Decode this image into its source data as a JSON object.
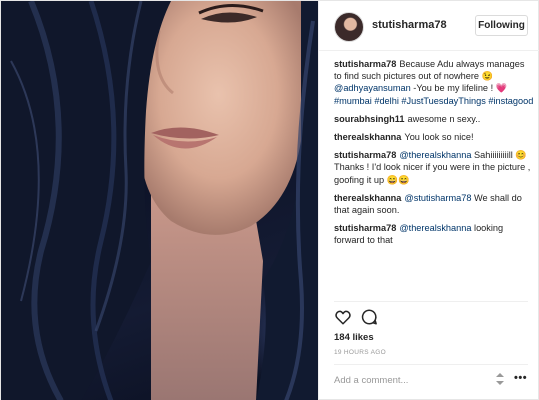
{
  "post": {
    "author": "stutisharma78",
    "follow_label": "Following"
  },
  "comments": [
    {
      "user": "stutisharma78",
      "parts": [
        {
          "text": "Because Adu always manages to find such pictures out of nowhere 😉 ",
          "link": false
        },
        {
          "text": "@adhyayansuman",
          "link": true
        },
        {
          "text": " -You be my lifeline ! 💗 ",
          "link": false
        },
        {
          "text": "#mumbai #delhi #JustTuesdayThings #instagood",
          "link": true
        }
      ]
    },
    {
      "user": "sourabhsingh11",
      "parts": [
        {
          "text": "awesome n sexy..",
          "link": false
        }
      ]
    },
    {
      "user": "therealskhanna",
      "parts": [
        {
          "text": "You look so nice!",
          "link": false
        }
      ]
    },
    {
      "user": "stutisharma78",
      "parts": [
        {
          "text": "@therealskhanna",
          "link": true
        },
        {
          "text": " Sahiiiiiiiiill 😊 Thanks ! I'd look nicer if you were in the picture , goofing it up 😄😄",
          "link": false
        }
      ]
    },
    {
      "user": "therealskhanna",
      "parts": [
        {
          "text": "@stutisharma78",
          "link": true
        },
        {
          "text": " We shall do that again soon.",
          "link": false
        }
      ]
    },
    {
      "user": "stutisharma78",
      "parts": [
        {
          "text": "@therealskhanna",
          "link": true
        },
        {
          "text": " looking forward to that",
          "link": false
        }
      ]
    }
  ],
  "likes": "184 likes",
  "time_ago": "19 HOURS AGO",
  "add_comment_placeholder": "Add a comment...",
  "more_label": "•••",
  "icons": {
    "like": "heart-icon",
    "comment": "comment-bubble-icon",
    "options": "more-options-icon"
  },
  "colors": {
    "link": "#003569",
    "text": "#262626",
    "muted": "#999999",
    "border": "#efefef"
  }
}
